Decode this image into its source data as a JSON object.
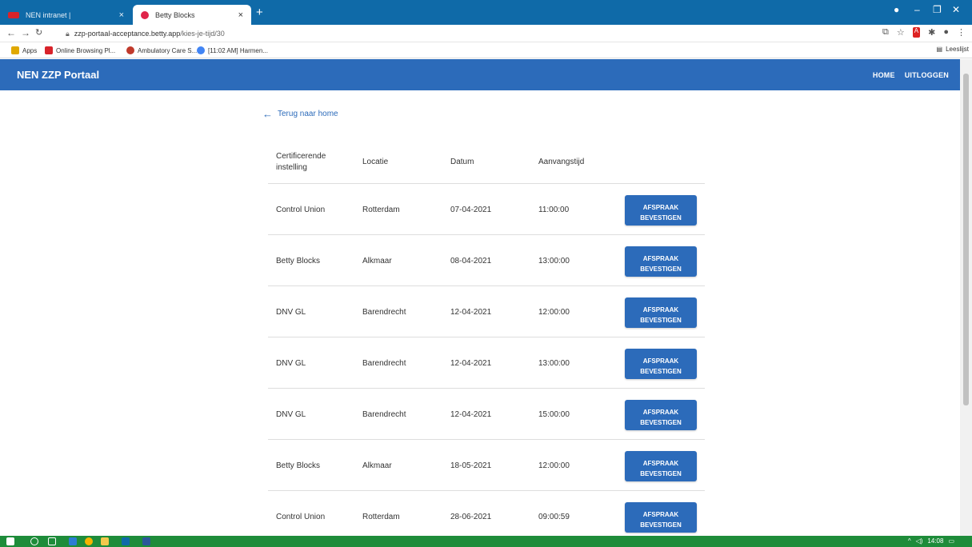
{
  "browser": {
    "tabs": [
      {
        "title": "NEN intranet |",
        "close": "×"
      },
      {
        "title": "Betty Blocks",
        "close": "×"
      }
    ],
    "new_tab": "+",
    "url": "zzp-portaal-acceptance.betty.app",
    "url_path": "/kies-je-tijd/30",
    "bookmarks": [
      {
        "label": "Apps",
        "color": "#e0a800"
      },
      {
        "label": "Online Browsing Pl...",
        "color": "#d8232a"
      },
      {
        "label": "Ambulatory Care S...",
        "color": "#c0392b"
      },
      {
        "label": "[11:02 AM] Harmen...",
        "color": "#4285f4"
      }
    ],
    "reading_list": "Leeslijst"
  },
  "app": {
    "title": "NEN ZZP Portaal",
    "nav": {
      "home": "HOME",
      "logout": "UITLOGGEN"
    },
    "accent": "#2c6bba"
  },
  "back_link": "Terug naar home",
  "table": {
    "headers": [
      "Certificerende instelling",
      "Locatie",
      "Datum",
      "Aanvangstijd"
    ],
    "button_label": "AFSPRAAK BEVESTIGEN",
    "rows": [
      {
        "instelling": "Control Union",
        "locatie": "Rotterdam",
        "datum": "07-04-2021",
        "tijd": "11:00:00"
      },
      {
        "instelling": "Betty Blocks",
        "locatie": "Alkmaar",
        "datum": "08-04-2021",
        "tijd": "13:00:00"
      },
      {
        "instelling": "DNV GL",
        "locatie": "Barendrecht",
        "datum": "12-04-2021",
        "tijd": "12:00:00"
      },
      {
        "instelling": "DNV GL",
        "locatie": "Barendrecht",
        "datum": "12-04-2021",
        "tijd": "13:00:00"
      },
      {
        "instelling": "DNV GL",
        "locatie": "Barendrecht",
        "datum": "12-04-2021",
        "tijd": "15:00:00"
      },
      {
        "instelling": "Betty Blocks",
        "locatie": "Alkmaar",
        "datum": "18-05-2021",
        "tijd": "12:00:00"
      },
      {
        "instelling": "Control Union",
        "locatie": "Rotterdam",
        "datum": "28-06-2021",
        "tijd": "09:00:59"
      }
    ]
  },
  "taskbar": {
    "time": "14:08"
  }
}
